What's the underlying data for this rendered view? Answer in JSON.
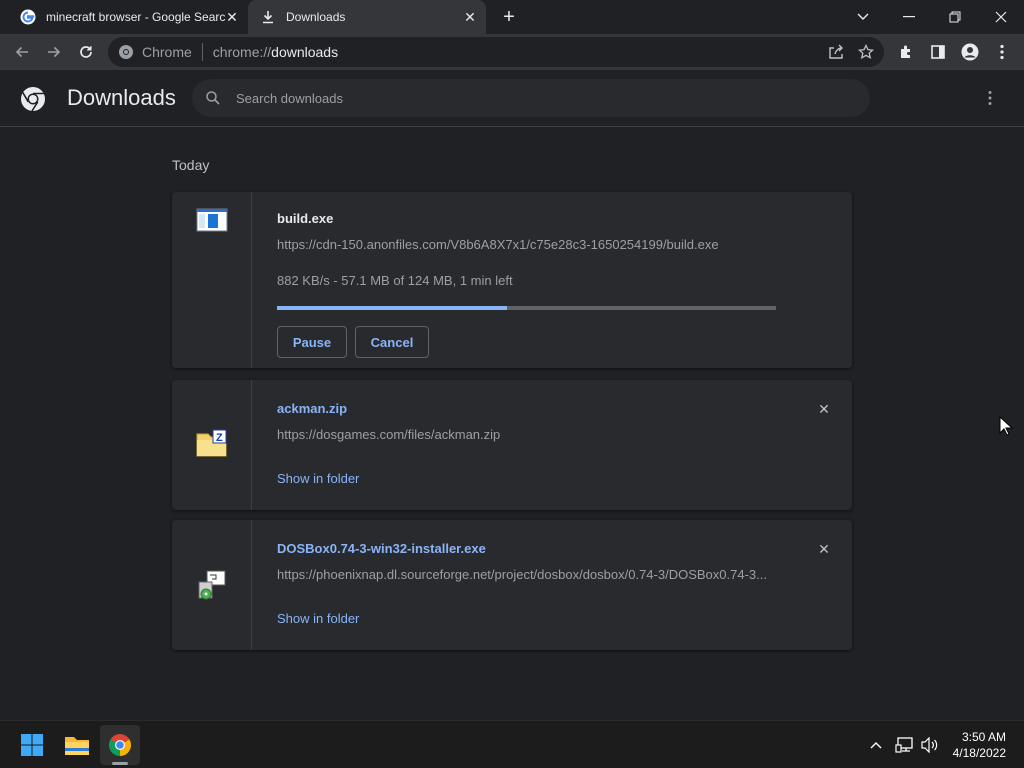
{
  "tabs": [
    {
      "title": "minecraft browser - Google Search",
      "favicon": "google-g-icon"
    },
    {
      "title": "Downloads",
      "favicon": "download-icon"
    }
  ],
  "omnibox": {
    "chip_label": "Chrome",
    "url_scheme": "chrome://",
    "url_host": "downloads"
  },
  "page": {
    "title": "Downloads",
    "search_placeholder": "Search downloads",
    "section_label": "Today"
  },
  "downloads": [
    {
      "name": "build.exe",
      "url": "https://cdn-150.anonfiles.com/V8b6A8X7x1/c75e28c3-1650254199/build.exe",
      "status": "882 KB/s - 57.1 MB of 124 MB, 1 min left",
      "progress": 0.46,
      "pause_label": "Pause",
      "cancel_label": "Cancel",
      "icon": "exe-window-icon"
    },
    {
      "name": "ackman.zip",
      "url": "https://dosgames.com/files/ackman.zip",
      "action_label": "Show in folder",
      "icon": "zip-folder-icon"
    },
    {
      "name": "DOSBox0.74-3-win32-installer.exe",
      "url": "https://phoenixnap.dl.sourceforge.net/project/dosbox/dosbox/0.74-3/DOSBox0.74-3...",
      "action_label": "Show in folder",
      "icon": "installer-icon"
    }
  ],
  "taskbar": {
    "time": "3:50 AM",
    "date": "4/18/2022"
  },
  "colors": {
    "accent": "#8ab4f8",
    "background": "#202124",
    "card": "#292a2d"
  }
}
